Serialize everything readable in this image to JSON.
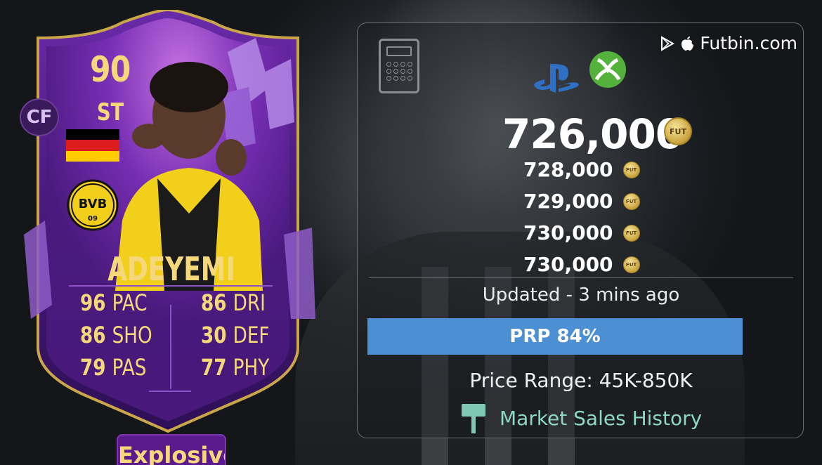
{
  "card": {
    "rating": "90",
    "position": "ST",
    "alt_position": "CF",
    "club_badge_text": "BVB",
    "club_badge_year": "09",
    "name": "ADEYEMI",
    "stats_left": [
      {
        "value": "96",
        "label": "PAC"
      },
      {
        "value": "86",
        "label": "SHO"
      },
      {
        "value": "79",
        "label": "PAS"
      }
    ],
    "stats_right": [
      {
        "value": "86",
        "label": "DRI"
      },
      {
        "value": "30",
        "label": "DEF"
      },
      {
        "value": "77",
        "label": "PHY"
      }
    ],
    "chem_style": "Explosive",
    "colors": {
      "frame": "#4a1a78",
      "accent": "#f6d87c",
      "border_gold": "#c9a64a"
    }
  },
  "panel": {
    "source": "Futbin.com",
    "source_icons": [
      "google-play-icon",
      "apple-icon"
    ],
    "platform_icons": [
      "calculator-icon",
      "playstation-icon",
      "xbox-icon"
    ],
    "price_main": "726,000",
    "coin_label": "FUT",
    "prices": [
      "728,000",
      "729,000",
      "730,000",
      "730,000"
    ],
    "updated": "Updated - 3 mins ago",
    "prp": "PRP 84%",
    "prp_fraction": 0.84,
    "price_range": "Price Range: 45K-850K",
    "history_link": "Market Sales History",
    "colors": {
      "prp_bar": "#4d8fd3",
      "link": "#8fd6c4",
      "xbox": "#54b23c",
      "playstation": "#2f6fc4"
    }
  }
}
